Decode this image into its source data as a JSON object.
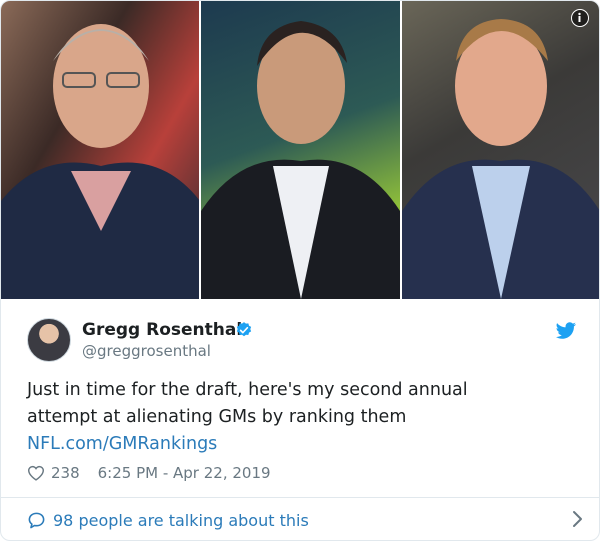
{
  "media": {
    "photos": [
      {
        "name": "photo-1"
      },
      {
        "name": "photo-2"
      },
      {
        "name": "photo-3"
      }
    ],
    "info_icon": "info-icon"
  },
  "tweet": {
    "author_name": "Gregg Rosenthal",
    "handle": "@greggrosenthal",
    "text_lines": [
      "Just in time for the draft, here's my second annual",
      "attempt at alienating GMs by ranking them"
    ],
    "link_text": "NFL.com/GMRankings",
    "like_count": "238",
    "timestamp": "6:25 PM - Apr 22, 2019",
    "icons": {
      "verified": "verified-badge-icon",
      "brand": "twitter-bird-icon",
      "like": "heart-icon",
      "comments": "speech-bubble-icon",
      "more": "chevron-right-icon"
    }
  },
  "footer": {
    "talking_text": "98 people are talking about this"
  },
  "colors": {
    "link": "#2b7bb9",
    "text": "#1c2022",
    "secondary": "#697882",
    "border": "#e1e8ed",
    "verified": "#1da1f2"
  }
}
